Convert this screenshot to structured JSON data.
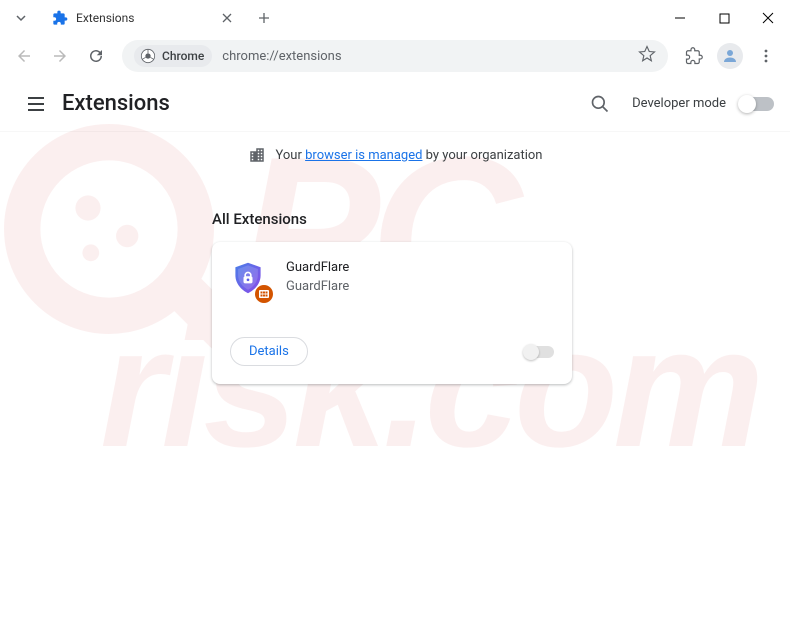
{
  "tab": {
    "title": "Extensions"
  },
  "omnibox": {
    "chip": "Chrome",
    "url": "chrome://extensions"
  },
  "header": {
    "title": "Extensions",
    "dev_mode": "Developer mode"
  },
  "managed": {
    "prefix": "Your ",
    "link": "browser is managed",
    "suffix": " by your organization"
  },
  "section": {
    "title": "All Extensions"
  },
  "extension": {
    "name": "GuardFlare",
    "description": "GuardFlare",
    "details": "Details"
  }
}
